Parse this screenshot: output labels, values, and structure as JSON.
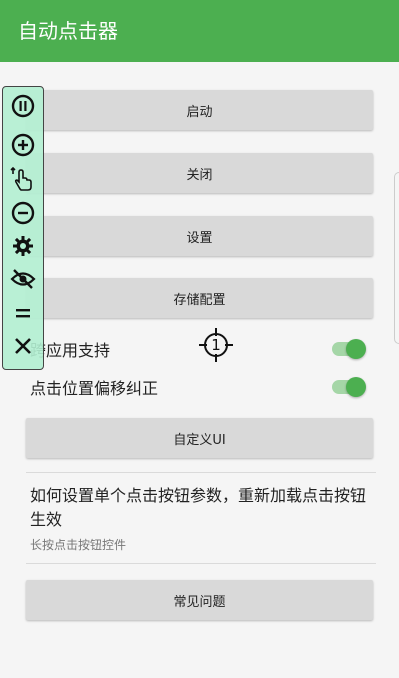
{
  "app": {
    "title": "自动点击器"
  },
  "buttons": {
    "start": "启动",
    "close": "关闭",
    "settings": "设置",
    "save_config": "存储配置",
    "custom_ui": "自定义UI",
    "faq": "常见问题"
  },
  "toggles": [
    {
      "label": "跨应用支持",
      "on": true
    },
    {
      "label": "点击位置偏移纠正",
      "on": true
    }
  ],
  "help": {
    "title": "如何设置单个点击按钮参数，重新加载点击按钮生效",
    "subtitle": "长按点击按钮控件"
  },
  "crosshair": {
    "number": "1"
  },
  "floating_toolbar": {
    "icons": [
      "pause-icon",
      "add-icon",
      "tap-gesture-icon",
      "remove-icon",
      "gear-icon",
      "eye-off-icon",
      "equals-icon",
      "close-icon"
    ]
  },
  "colors": {
    "primary": "#4caf50",
    "switch_track": "#a5d6a7",
    "button": "#d9d9d9",
    "background": "#f5f5f5"
  }
}
